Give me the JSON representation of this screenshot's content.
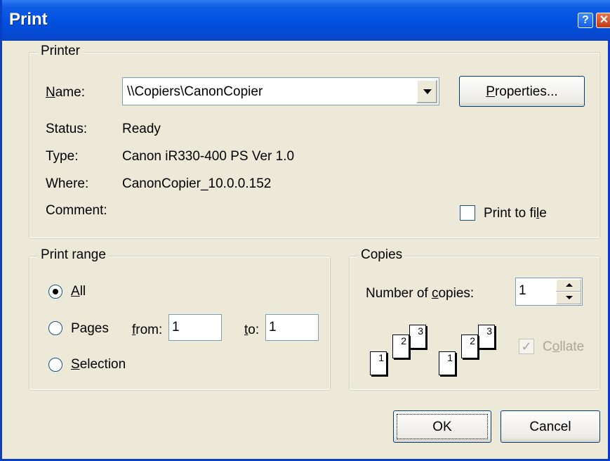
{
  "dialog": {
    "title": "Print",
    "help_icon": "help-icon",
    "close_icon": "close-icon"
  },
  "printer": {
    "group_label": "Printer",
    "name_label": "Name:",
    "name_value": "\\\\Copiers\\CanonCopier",
    "properties_label": "Properties...",
    "status_label": "Status:",
    "status_value": "Ready",
    "type_label": "Type:",
    "type_value": "Canon iR330-400 PS Ver 1.0",
    "where_label": "Where:",
    "where_value": "CanonCopier_10.0.0.152",
    "comment_label": "Comment:",
    "print_to_file_label": "Print to file",
    "print_to_file_checked": false
  },
  "print_range": {
    "group_label": "Print range",
    "all_label": "All",
    "pages_label": "Pages",
    "from_label": "from:",
    "from_value": "1",
    "to_label": "to:",
    "to_value": "1",
    "selection_label": "Selection",
    "selected": "All"
  },
  "copies": {
    "group_label": "Copies",
    "number_label": "Number of copies:",
    "number_value": "1",
    "collate_label": "Collate",
    "collate_checked": true,
    "collate_enabled": false,
    "collate_pages_1": [
      "1",
      "2",
      "3"
    ],
    "collate_pages_2": [
      "1",
      "2",
      "3"
    ]
  },
  "buttons": {
    "ok": "OK",
    "cancel": "Cancel"
  }
}
